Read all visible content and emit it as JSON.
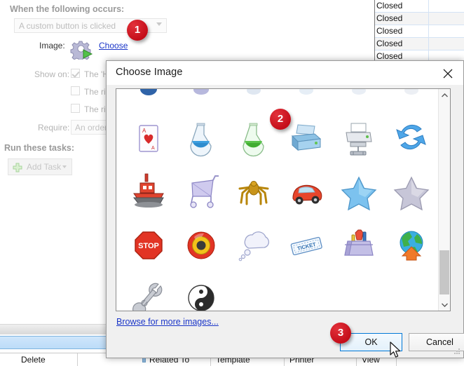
{
  "background_form": {
    "section_title": "When the following occurs:",
    "trigger_combo_value": "A custom button is clicked",
    "image_label": "Image:",
    "choose_link": "Choose",
    "show_on_label": "Show on:",
    "show_on_options": [
      {
        "label": "The 'Ho",
        "checked": true
      },
      {
        "label": "The rig",
        "checked": false
      },
      {
        "label": "The rig",
        "checked": false
      }
    ],
    "require_label": "Require:",
    "require_value": "An order t",
    "tasks_title": "Run these tasks:",
    "add_task_label": "Add Task"
  },
  "background_grid": {
    "rows": [
      "Closed",
      "Closed",
      "Closed",
      "Closed",
      "Closed"
    ]
  },
  "background_columns": [
    {
      "label": "Delete"
    },
    {
      "label": "Related To"
    },
    {
      "label": "Template"
    },
    {
      "label": "Printer"
    },
    {
      "label": "View"
    }
  ],
  "dialog": {
    "title": "Choose Image",
    "close_icon": "close-icon",
    "browse_link": "Browse for more images...",
    "ok_label": "OK",
    "cancel_label": "Cancel",
    "icons": [
      {
        "name": "playing-card-icon",
        "row": 1,
        "col": 1
      },
      {
        "name": "blue-flask-icon",
        "row": 1,
        "col": 2
      },
      {
        "name": "green-flask-icon",
        "row": 1,
        "col": 3
      },
      {
        "name": "printer-icon",
        "row": 1,
        "col": 4
      },
      {
        "name": "network-printer-icon",
        "row": 1,
        "col": 5
      },
      {
        "name": "refresh-arrows-icon",
        "row": 1,
        "col": 6
      },
      {
        "name": "tugboat-icon",
        "row": 2,
        "col": 1
      },
      {
        "name": "shopping-cart-icon",
        "row": 2,
        "col": 2
      },
      {
        "name": "spider-icon",
        "row": 2,
        "col": 3
      },
      {
        "name": "red-car-icon",
        "row": 2,
        "col": 4
      },
      {
        "name": "blue-star-icon",
        "row": 2,
        "col": 5
      },
      {
        "name": "grey-star-icon",
        "row": 2,
        "col": 6
      },
      {
        "name": "stop-sign-icon",
        "row": 3,
        "col": 1,
        "text": "STOP"
      },
      {
        "name": "target-icon",
        "row": 3,
        "col": 2
      },
      {
        "name": "thought-cloud-icon",
        "row": 3,
        "col": 3
      },
      {
        "name": "ticket-icon",
        "row": 3,
        "col": 4,
        "text": "TICKET"
      },
      {
        "name": "toolbox-icon",
        "row": 3,
        "col": 5
      },
      {
        "name": "globe-upload-icon",
        "row": 3,
        "col": 6
      },
      {
        "name": "wrench-icon",
        "row": 4,
        "col": 1
      },
      {
        "name": "yin-yang-icon",
        "row": 4,
        "col": 2
      }
    ]
  },
  "annotations": [
    {
      "id": "badge-1",
      "number": "1"
    },
    {
      "id": "badge-2",
      "number": "2"
    },
    {
      "id": "badge-3",
      "number": "3"
    }
  ],
  "colors": {
    "badge_red": "#c40d19",
    "link_blue": "#1a35c8",
    "focus_blue": "#0078d7",
    "grid_line": "#d4e3f5",
    "selection_blue": "#bcdcf8"
  }
}
